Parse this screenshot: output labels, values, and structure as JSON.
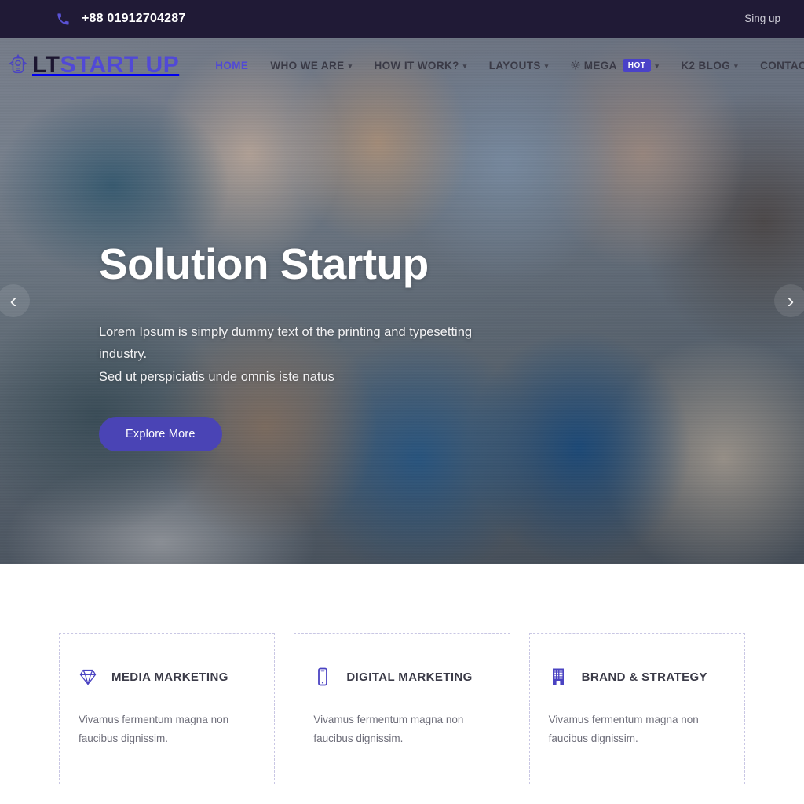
{
  "topbar": {
    "phone_icon": "phone-icon",
    "phone_number": "+88 01912704287",
    "signup_label": "Sing up"
  },
  "brand": {
    "icon": "rocket-badge-icon",
    "name_primary": "LT",
    "name_secondary": "START UP"
  },
  "nav": {
    "items": [
      {
        "label": "HOME",
        "has_caret": false,
        "active": true
      },
      {
        "label": "WHO WE ARE",
        "has_caret": true,
        "active": false
      },
      {
        "label": "HOW IT WORK?",
        "has_caret": true,
        "active": false
      },
      {
        "label": "LAYOUTS",
        "has_caret": true,
        "active": false
      },
      {
        "label": "MEGA",
        "has_caret": true,
        "active": false,
        "icon": "gear-icon",
        "badge": "HOT"
      },
      {
        "label": "K2 BLOG",
        "has_caret": true,
        "active": false
      },
      {
        "label": "CONTACT",
        "has_caret": false,
        "active": false
      }
    ],
    "menu_toggle": "hamburger-menu"
  },
  "hero": {
    "title": "Solution Startup",
    "subtitle_line1": "Lorem Ipsum is simply dummy text of the printing and typesetting industry.",
    "subtitle_line2": "Sed ut perspiciatis unde omnis iste natus",
    "cta_label": "Explore More",
    "prev_arrow": "‹",
    "next_arrow": "›"
  },
  "services": {
    "cards": [
      {
        "icon": "diamond-icon",
        "title": "MEDIA MARKETING",
        "text": "Vivamus fermentum magna non faucibus dignissim."
      },
      {
        "icon": "mobile-phone-icon",
        "title": "DIGITAL MARKETING",
        "text": "Vivamus fermentum magna non faucibus dignissim."
      },
      {
        "icon": "building-icon",
        "title": "BRAND & STRATEGY",
        "text": "Vivamus fermentum magna non faucibus dignissim."
      }
    ]
  },
  "colors": {
    "brand_purple": "#5149d6",
    "accent_purple": "#4a44b5",
    "topbar_bg": "#201a36",
    "badge_bg": "#4a42c8",
    "card_border": "#c9c7e4"
  }
}
